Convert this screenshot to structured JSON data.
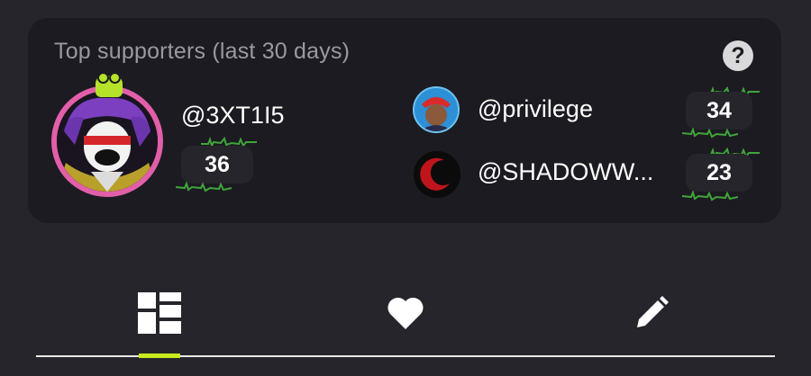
{
  "card": {
    "title": "Top supporters (last 30 days)",
    "help_label": "?"
  },
  "top_supporter": {
    "username": "@3XT1I5",
    "count": "36"
  },
  "supporters": [
    {
      "username": "@privilege",
      "count": "34"
    },
    {
      "username": "@SHADOWW...",
      "count": "23"
    }
  ],
  "tabs": [
    {
      "icon": "grid-icon",
      "active": true
    },
    {
      "icon": "heart-icon",
      "active": false
    },
    {
      "icon": "pencil-icon",
      "active": false
    }
  ],
  "colors": {
    "background": "#26252b",
    "card": "#1c1b21",
    "accent": "#c8ec1b",
    "avatar_ring": "#e15fa8"
  }
}
